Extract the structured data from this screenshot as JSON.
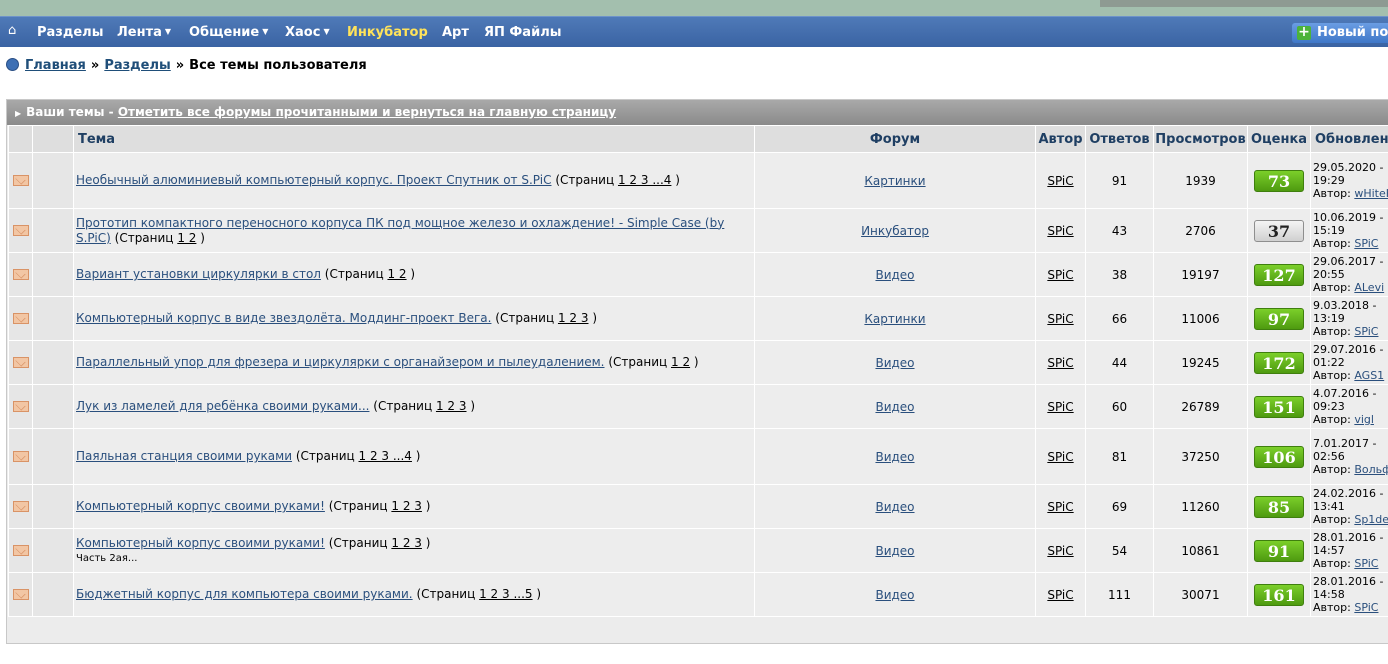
{
  "nav": {
    "items": [
      {
        "label": "Разделы",
        "caret": false,
        "accent": false
      },
      {
        "label": "Лента",
        "caret": true,
        "accent": false
      },
      {
        "label": "Общение",
        "caret": true,
        "accent": false
      },
      {
        "label": "Хаос",
        "caret": true,
        "accent": false
      },
      {
        "label": "Инкубатор",
        "caret": false,
        "accent": true
      },
      {
        "label": "Арт",
        "caret": false,
        "accent": false
      },
      {
        "label": "ЯП Файлы",
        "caret": false,
        "accent": false
      }
    ],
    "new_button": "Новый по",
    "colors": {
      "bar": "#3a63a3",
      "accent": "#ffe35a"
    }
  },
  "breadcrumb": {
    "home": "Главная",
    "sep1": "»",
    "sections": "Разделы",
    "sep2": "»",
    "current": "Все темы пользователя"
  },
  "panel": {
    "title": "Ваши темы",
    "title_sep": " - ",
    "mark_read_link": "Отметить все форумы прочитанными и вернуться на главную страницу"
  },
  "table": {
    "headers": {
      "topic": "Тема",
      "forum": "Форум",
      "author": "Автор",
      "replies": "Ответов",
      "views": "Просмотров",
      "rating": "Оценка",
      "updated": "Обновлен"
    },
    "rows": [
      {
        "title": "Необычный алюминиевый компьютерный корпус. Проект Спутник от S.PiC",
        "pages_label": "(Страниц",
        "pages": "1 2 3 ...4",
        "pages_end": ")",
        "sub": "",
        "forum": "Картинки",
        "author": "SPiC",
        "replies": "91",
        "views": "1939",
        "rating": "73",
        "rating_style": "positive",
        "upd_date": "29.05.2020 -",
        "upd_time": "19:29",
        "upd_author_label": "Автор:",
        "upd_author": "wHiteHands"
      },
      {
        "title": "Прототип компактного переносного корпуса ПК под мощное железо и охлаждение! - Simple Case (by S.PiC)",
        "pages_label": "(Страниц",
        "pages": "1 2",
        "pages_end": ")",
        "sub": "",
        "forum": "Инкубатор",
        "author": "SPiC",
        "replies": "43",
        "views": "2706",
        "rating": "37",
        "rating_style": "neutral",
        "upd_date": "10.06.2019 -",
        "upd_time": "15:19",
        "upd_author_label": "Автор:",
        "upd_author": "SPiC"
      },
      {
        "title": "Вариант установки циркулярки в стол",
        "pages_label": "(Страниц",
        "pages": "1 2",
        "pages_end": ")",
        "sub": "",
        "forum": "Видео",
        "author": "SPiC",
        "replies": "38",
        "views": "19197",
        "rating": "127",
        "rating_style": "positive",
        "upd_date": "29.06.2017 -",
        "upd_time": "20:55",
        "upd_author_label": "Автор:",
        "upd_author": "ALevi"
      },
      {
        "title": "Компьютерный корпус в виде звездолёта. Моддинг-проект Вега.",
        "pages_label": "(Страниц",
        "pages": "1 2 3",
        "pages_end": ")",
        "sub": "",
        "forum": "Картинки",
        "author": "SPiC",
        "replies": "66",
        "views": "11006",
        "rating": "97",
        "rating_style": "positive",
        "upd_date": "9.03.2018 -",
        "upd_time": "13:19",
        "upd_author_label": "Автор:",
        "upd_author": "SPiC"
      },
      {
        "title": "Параллельный упор для фрезера и циркулярки с органайзером и пылеудалением.",
        "pages_label": "(Страниц",
        "pages": "1 2",
        "pages_end": ")",
        "sub": "",
        "forum": "Видео",
        "author": "SPiC",
        "replies": "44",
        "views": "19245",
        "rating": "172",
        "rating_style": "positive",
        "upd_date": "29.07.2016 -",
        "upd_time": "01:22",
        "upd_author_label": "Автор:",
        "upd_author": "AGS1"
      },
      {
        "title": "Лук из ламелей для ребёнка своими руками...",
        "pages_label": "(Страниц",
        "pages": "1 2 3",
        "pages_end": ")",
        "sub": "",
        "forum": "Видео",
        "author": "SPiC",
        "replies": "60",
        "views": "26789",
        "rating": "151",
        "rating_style": "positive",
        "upd_date": "4.07.2016 -",
        "upd_time": "09:23",
        "upd_author_label": "Автор:",
        "upd_author": "vigl"
      },
      {
        "title": "Паяльная станция своими руками",
        "pages_label": "(Страниц",
        "pages": "1 2 3 ...4",
        "pages_end": ")",
        "sub": "",
        "forum": "Видео",
        "author": "SPiC",
        "replies": "81",
        "views": "37250",
        "rating": "106",
        "rating_style": "positive",
        "upd_date": "7.01.2017 -",
        "upd_time": "02:56",
        "upd_author_label": "Автор:",
        "upd_author": "Вольфрамыч"
      },
      {
        "title": "Компьютерный корпус своими руками!",
        "pages_label": "(Страниц",
        "pages": "1 2 3",
        "pages_end": ")",
        "sub": "",
        "forum": "Видео",
        "author": "SPiC",
        "replies": "69",
        "views": "11260",
        "rating": "85",
        "rating_style": "positive",
        "upd_date": "24.02.2016 -",
        "upd_time": "13:41",
        "upd_author_label": "Автор:",
        "upd_author": "Sp1de"
      },
      {
        "title": "Компьютерный корпус своими руками!",
        "pages_label": "(Страниц",
        "pages": "1 2 3",
        "pages_end": ")",
        "sub": "Часть 2ая...",
        "forum": "Видео",
        "author": "SPiC",
        "replies": "54",
        "views": "10861",
        "rating": "91",
        "rating_style": "positive",
        "upd_date": "28.01.2016 -",
        "upd_time": "14:57",
        "upd_author_label": "Автор:",
        "upd_author": "SPiC"
      },
      {
        "title": "Бюджетный корпус для компьютера своими руками.",
        "pages_label": "(Страниц",
        "pages": "1 2 3 ...5",
        "pages_end": ")",
        "sub": "",
        "forum": "Видео",
        "author": "SPiC",
        "replies": "111",
        "views": "30071",
        "rating": "161",
        "rating_style": "positive",
        "upd_date": "28.01.2016 -",
        "upd_time": "14:58",
        "upd_author_label": "Автор:",
        "upd_author": "SPiC"
      }
    ]
  },
  "icons": {
    "home": "home-icon",
    "new_topic": "plus-icon",
    "breadcrumb": "bullet-icon",
    "row": "envelope-icon"
  }
}
